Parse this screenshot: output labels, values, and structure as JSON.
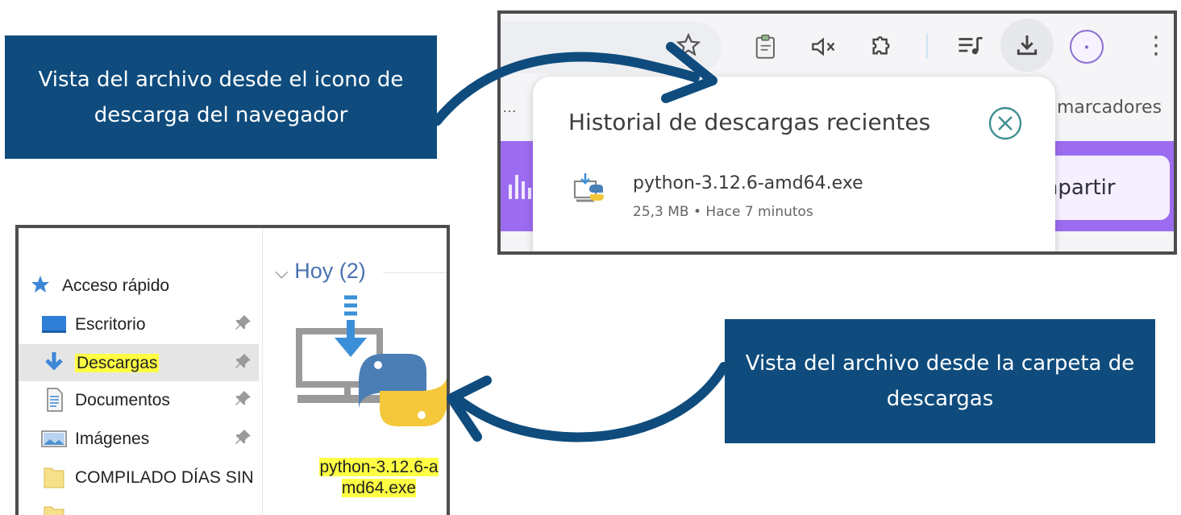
{
  "callouts": {
    "browser": "Vista del archivo desde el icono de descarga del navegador",
    "folder": "Vista del archivo desde la carpeta de descargas"
  },
  "browser": {
    "toolbar_icons": [
      "star-icon",
      "clipboard-icon",
      "mute-icon",
      "extensions-icon",
      "media-icon",
      "download-icon",
      "profile-icon",
      "menu-icon"
    ],
    "bookmarks_fragment": "marcadores",
    "bookmarks_ellipsis": "…",
    "share_fragment": "mpartir",
    "downloads_popup": {
      "title": "Historial de descargas recientes",
      "file_name": "python-3.12.6-amd64.exe",
      "file_meta": "25,3 MB • Hace 7 minutos"
    }
  },
  "explorer": {
    "quick_access": "Acceso rápido",
    "nav_items": [
      {
        "label": "Escritorio",
        "pinned": true
      },
      {
        "label": "Descargas",
        "pinned": true,
        "selected": true,
        "highlighted": true
      },
      {
        "label": "Documentos",
        "pinned": true
      },
      {
        "label": "Imágenes",
        "pinned": true
      },
      {
        "label": "COMPILADO DÍAS SIN",
        "pinned": false
      }
    ],
    "group_header": "Hoy (2)",
    "file_name_line1": "python-3.12.6-a",
    "file_name_line2": "md64.exe"
  },
  "colors": {
    "callout_bg": "#0f4c7d",
    "arrow": "#0f4c7d",
    "highlight": "#ffff44",
    "purple_band": "#9c6cf0"
  }
}
